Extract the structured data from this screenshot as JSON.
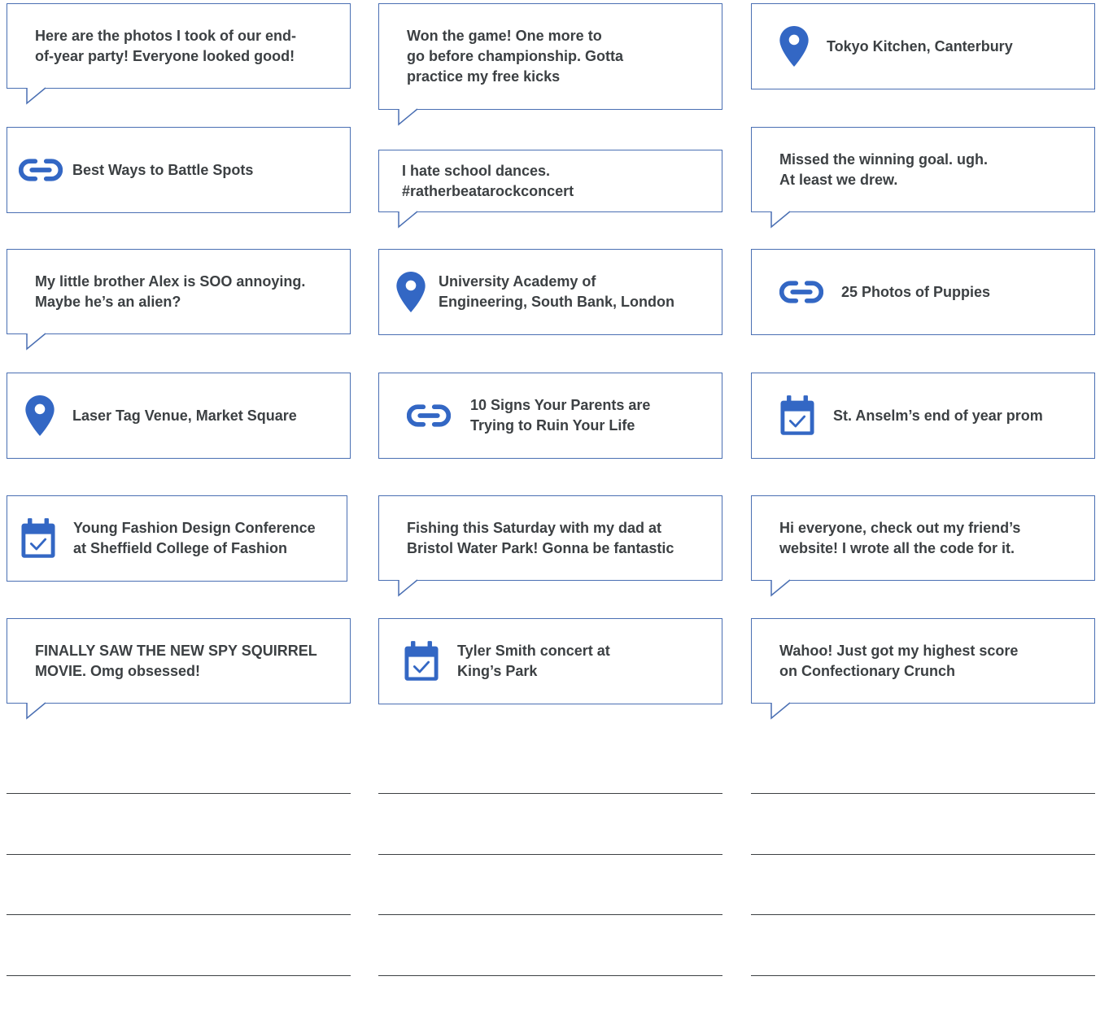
{
  "cards": {
    "c1": {
      "text": "Here are the photos I took of our end-\nof-year party! Everyone looked good!",
      "kind": "post"
    },
    "c2": {
      "text": "Won the game! One more to\ngo before championship. Gotta\npractice my free kicks",
      "kind": "post"
    },
    "c3": {
      "text": "Tokyo Kitchen, Canterbury",
      "kind": "location",
      "icon": "location-pin-icon"
    },
    "c4": {
      "text": "Best Ways to Battle Spots",
      "kind": "link",
      "icon": "link-icon"
    },
    "c5": {
      "text": "I hate school dances.\n#ratherbeatarockconcert",
      "kind": "post"
    },
    "c6": {
      "text": "Missed the winning goal. ugh.\nAt least we drew.",
      "kind": "post"
    },
    "c7": {
      "text": "My little brother Alex is SOO annoying.\nMaybe he’s an alien?",
      "kind": "post"
    },
    "c8": {
      "text": "University Academy of\nEngineering, South Bank, London",
      "kind": "location",
      "icon": "location-pin-icon"
    },
    "c9": {
      "text": "25 Photos of Puppies",
      "kind": "link",
      "icon": "link-icon"
    },
    "c10": {
      "text": "Laser Tag Venue, Market Square",
      "kind": "location",
      "icon": "location-pin-icon"
    },
    "c11": {
      "text": "10 Signs Your Parents are\nTrying to Ruin Your Life",
      "kind": "link",
      "icon": "link-icon"
    },
    "c12": {
      "text": "St. Anselm’s end of year prom",
      "kind": "event",
      "icon": "calendar-icon"
    },
    "c13": {
      "text": "Young Fashion Design Conference\nat Sheffield College of Fashion",
      "kind": "event",
      "icon": "calendar-icon"
    },
    "c14": {
      "text": "Fishing this Saturday with my dad at\nBristol Water Park! Gonna be fantastic",
      "kind": "post"
    },
    "c15": {
      "text": "Hi everyone, check out my friend’s\nwebsite! I wrote all the code for it.",
      "kind": "post"
    },
    "c16": {
      "text": "FINALLY SAW THE NEW SPY SQUIRREL\nMOVIE. Omg obsessed!",
      "kind": "post"
    },
    "c17": {
      "text": "Tyler Smith concert at\nKing’s Park",
      "kind": "event",
      "icon": "calendar-icon"
    },
    "c18": {
      "text": "Wahoo! Just got my highest score\non Confectionary Crunch",
      "kind": "post"
    }
  },
  "colors": {
    "border": "#4a6fb3",
    "icon": "#3367c4",
    "text": "#3c4043",
    "rule": "#3c4043"
  }
}
